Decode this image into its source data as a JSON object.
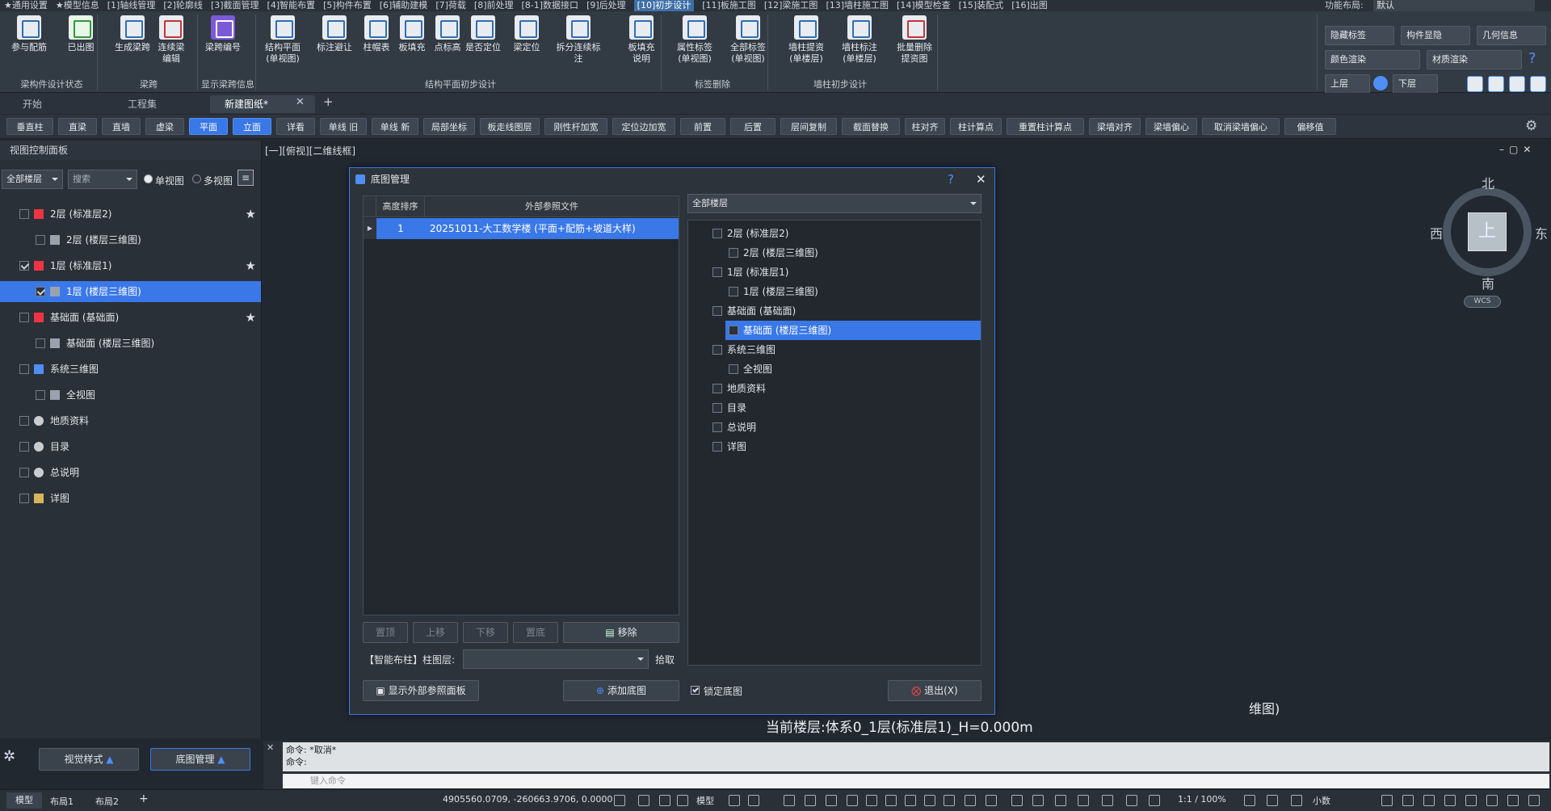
{
  "menubar": [
    "★通用设置",
    "★模型信息",
    "[1]轴线管理",
    "[2]轮廓线",
    "[3]截面管理",
    "[4]智能布置",
    "[5]构件布置",
    "[6]辅助建模",
    "[7]荷载",
    "[8]前处理",
    "[8-1]数据接口",
    "[9]后处理",
    "[10]初步设计",
    "[11]板施工图",
    "[12]梁施工图",
    "[13]墙柱施工图",
    "[14]模型检查",
    "[15]装配式",
    "[16]出图"
  ],
  "menubar_active": 12,
  "layout_label": "功能布局:",
  "layout_value": "默认",
  "ribbon": {
    "buttons": [
      {
        "label": "参与配筋",
        "name": "participate-rebar-button"
      },
      {
        "label": "已出图",
        "name": "drawn-button"
      },
      {
        "label": "生成梁跨",
        "name": "generate-span-button"
      },
      {
        "label": "连续梁\n编辑",
        "name": "continuous-beam-edit-button"
      },
      {
        "label": "梁跨编号",
        "name": "span-number-button"
      },
      {
        "label": "结构平面\n(单视图)",
        "name": "structure-plan-button"
      },
      {
        "label": "标注避让",
        "name": "label-avoid-button"
      },
      {
        "label": "柱帽表",
        "name": "column-cap-table-button"
      },
      {
        "label": "板填充",
        "name": "slab-fill-button"
      },
      {
        "label": "点标高",
        "name": "point-elevation-button"
      },
      {
        "label": "是否定位",
        "name": "is-locate-button"
      },
      {
        "label": "梁定位",
        "name": "beam-locate-button"
      },
      {
        "label": "拆分连续标注",
        "name": "split-label-button"
      },
      {
        "label": "板填充\n说明",
        "name": "slab-fill-note-button"
      },
      {
        "label": "属性标签\n(单视图)",
        "name": "attr-label-button"
      },
      {
        "label": "全部标签\n(单视图)",
        "name": "all-label-button"
      },
      {
        "label": "墙柱提资\n(单楼层)",
        "name": "wall-column-data-button"
      },
      {
        "label": "墙柱标注\n(单楼层)",
        "name": "wall-column-label-button"
      },
      {
        "label": "批量删除\n提资图",
        "name": "batch-delete-button"
      }
    ],
    "groups": [
      "梁构件设计状态",
      "梁跨",
      "显示梁跨信息",
      "结构平面初步设计",
      "标签删除",
      "墙柱初步设计"
    ],
    "right": {
      "hide_label": "隐藏标签",
      "show_comp": "构件显隐",
      "geo_info": "几何信息",
      "color_render": "颜色渲染",
      "material_render": "材质渲染",
      "up_floor": "上层",
      "down_floor": "下层"
    }
  },
  "tabs": [
    {
      "label": "开始"
    },
    {
      "label": "工程集"
    },
    {
      "label": "新建图纸*"
    }
  ],
  "toolbar2": [
    "垂直柱",
    "直梁",
    "直墙",
    "虚梁",
    "平面",
    "立面",
    "详看",
    "单线 旧",
    "单线 新",
    "局部坐标",
    "板走线图层",
    "刚性杆加宽",
    "定位边加宽",
    "前置",
    "后置",
    "层间复制",
    "截面替换",
    "柱对齐",
    "柱计算点",
    "重置柱计算点",
    "梁墙对齐",
    "梁墙偏心",
    "取消梁墙偏心",
    "偏移值"
  ],
  "leftpanel": {
    "title": "视图控制面板",
    "floor_combo": "全部楼层",
    "search_placeholder": "搜索",
    "single_view": "单视图",
    "multi_view": "多视图",
    "tree": [
      {
        "label": "2层 (标准层2)",
        "level": 0
      },
      {
        "label": "2层 (楼层三维图)",
        "level": 1
      },
      {
        "label": "1层 (标准层1)",
        "level": 0
      },
      {
        "label": "1层 (楼层三维图)",
        "level": 1
      },
      {
        "label": "基础面 (基础面)",
        "level": 0
      },
      {
        "label": "基础面 (楼层三维图)",
        "level": 1
      },
      {
        "label": "系统三维图",
        "level": 0
      },
      {
        "label": "全视图",
        "level": 1
      },
      {
        "label": "地质资料",
        "level": 0
      },
      {
        "label": "目录",
        "level": 0
      },
      {
        "label": "总说明",
        "level": 0
      },
      {
        "label": "详图",
        "level": 0
      }
    ],
    "bottom": {
      "view_style": "视觉样式",
      "base_manage": "底图管理"
    }
  },
  "canvas": {
    "view_label": "[一][俯视][二维线框]",
    "floor_text": "当前楼层:体系0_1层(标准层1)_H=0.000m",
    "partial_text": "维图)",
    "compass": {
      "north": "北",
      "south": "南",
      "east": "东",
      "west": "西",
      "center": "上",
      "wcs": "WCS"
    }
  },
  "dialog": {
    "title": "底图管理",
    "help": "?",
    "close": "✕",
    "col_sort": "高度排序",
    "col_file": "外部参照文件",
    "rows": [
      {
        "order": "1",
        "file": "20251011-大工数学楼 (平面+配筋+坡道大样)"
      }
    ],
    "btn_top": "置顶",
    "btn_up": "上移",
    "btn_down": "下移",
    "btn_bottom": "置底",
    "btn_remove": "移除",
    "smart_label": "【智能布柱】柱图层:",
    "smart_value": "",
    "pick": "拾取",
    "show_panel": "显示外部参照面板",
    "add_base": "添加底图",
    "floor_combo": "全部楼层",
    "tree": [
      {
        "label": "2层 (标准层2)",
        "level": 0
      },
      {
        "label": "2层 (楼层三维图)",
        "level": 1
      },
      {
        "label": "1层 (标准层1)",
        "level": 0
      },
      {
        "label": "1层 (楼层三维图)",
        "level": 1
      },
      {
        "label": "基础面 (基础面)",
        "level": 0
      },
      {
        "label": "基础面 (楼层三维图)",
        "level": 1
      },
      {
        "label": "系统三维图",
        "level": 0
      },
      {
        "label": "全视图",
        "level": 1
      },
      {
        "label": "地质资料",
        "level": 0
      },
      {
        "label": "目录",
        "level": 0
      },
      {
        "label": "总说明",
        "level": 0
      },
      {
        "label": "详图",
        "level": 0
      }
    ],
    "lock": "锁定底图",
    "exit": "退出(X)"
  },
  "cmd": {
    "line1": "命令: *取消*",
    "line2": "命令:",
    "placeholder": "键入命令"
  },
  "status": {
    "tabs": [
      "模型",
      "布局1",
      "布局2"
    ],
    "coords": "4905560.0709, -260663.9706, 0.0000",
    "model": "模型",
    "scale": "1:1 / 100%",
    "decimal": "小数"
  },
  "colors": {
    "accent": "#3a78e8",
    "bg": "#212830"
  }
}
